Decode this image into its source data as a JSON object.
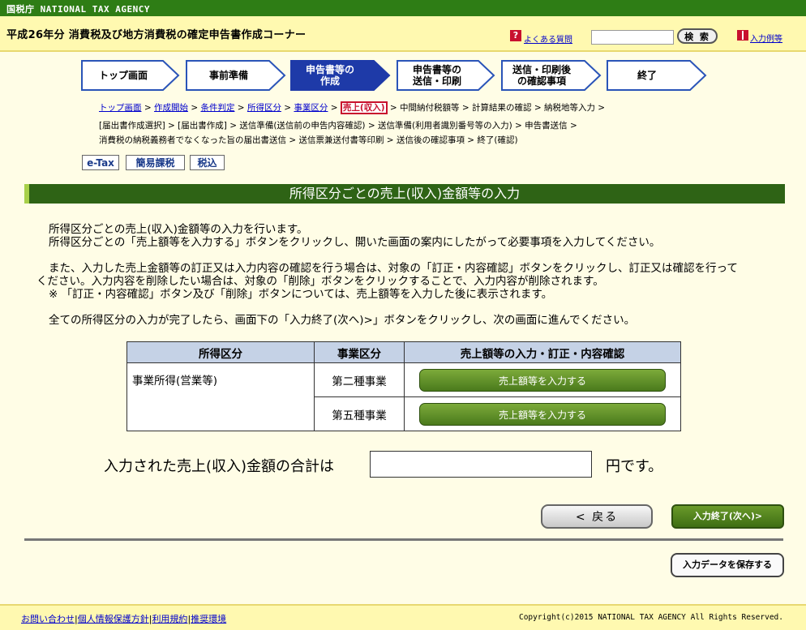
{
  "topbar": {
    "agency": "国税庁 NATIONAL TAX AGENCY"
  },
  "header": {
    "title": "平成26年分 消費税及び地方消費税の確定申告書作成コーナー",
    "faq_icon": "?",
    "faq_label": "よくある質問",
    "search_value": "",
    "search_button": "検 索",
    "input_example_label": "入力例等"
  },
  "steps": [
    {
      "label1": "トップ画面",
      "label2": "",
      "state": "inactive"
    },
    {
      "label1": "事前準備",
      "label2": "",
      "state": "inactive"
    },
    {
      "label1": "申告書等の",
      "label2": "作成",
      "state": "active"
    },
    {
      "label1": "申告書等の",
      "label2": "送信・印刷",
      "state": "inactive"
    },
    {
      "label1": "送信・印刷後",
      "label2": "の確認事項",
      "state": "inactive"
    },
    {
      "label1": "終了",
      "label2": "",
      "state": "inactive"
    }
  ],
  "breadcrumb": {
    "top": "トップ画面",
    "start": "作成開始",
    "conditions": "条件判定",
    "income_type": "所得区分",
    "business_type": "事業区分",
    "current": "売上(収入)",
    "sep": " > ",
    "line1_rest": "中間納付税額等 > 計算結果の確認 > 納税地等入力 >",
    "line2": "[届出書作成選択] > [届出書作成] > 送信準備(送信前の申告内容確認) > 送信準備(利用者識別番号等の入力) > 申告書送信 >",
    "line3": "消費税の納税義務者でなくなった旨の届出書送信 > 送信票兼送付書等印刷 > 送信後の確認事項 > 終了(確認)"
  },
  "tags": [
    "e-Tax",
    "簡易課税",
    "税込"
  ],
  "section_title": "所得区分ごとの売上(収入)金額等の入力",
  "instructions": {
    "p1": "所得区分ごとの売上(収入)金額等の入力を行います。",
    "p2": "所得区分ごとの「売上額等を入力する」ボタンをクリックし、開いた画面の案内にしたがって必要事項を入力してください。",
    "p3a": "また、入力した売上金額等の訂正又は入力内容の確認を行う場合は、対象の「訂正・内容確認」ボタンをクリックし、訂正又は確認を行って",
    "p3b": "ください。入力内容を削除したい場合は、対象の「削除」ボタンをクリックすることで、入力内容が削除されます。",
    "p4": "※ 「訂正・内容確認」ボタン及び「削除」ボタンについては、売上額等を入力した後に表示されます。",
    "p5": "全ての所得区分の入力が完了したら、画面下の「入力終了(次へ)>」ボタンをクリックし、次の画面に進んでください。"
  },
  "table": {
    "headers": [
      "所得区分",
      "事業区分",
      "売上額等の入力・訂正・内容確認"
    ],
    "income_category": "事業所得(営業等)",
    "rows": [
      {
        "business": "第二種事業",
        "button": "売上額等を入力する"
      },
      {
        "business": "第五種事業",
        "button": "売上額等を入力する"
      }
    ]
  },
  "total": {
    "label": "入力された売上(収入)金額の合計は",
    "value": "",
    "unit": "円です。"
  },
  "buttons": {
    "back": "< 戻る",
    "next": "入力終了(次へ)>",
    "save": "入力データを保存する"
  },
  "footer": {
    "links": [
      "お問い合わせ",
      "個人情報保護方針",
      "利用規約",
      "推奨環境"
    ],
    "separator": "|",
    "copyright": "Copyright(c)2015 NATIONAL TAX AGENCY All Rights Reserved."
  },
  "colors": {
    "brand_green": "#2e7d15",
    "header_yellow": "#fff9b0",
    "active_step": "#1e3aa8",
    "step_outline": "#2a54b8",
    "table_header": "#c5d2e6"
  }
}
